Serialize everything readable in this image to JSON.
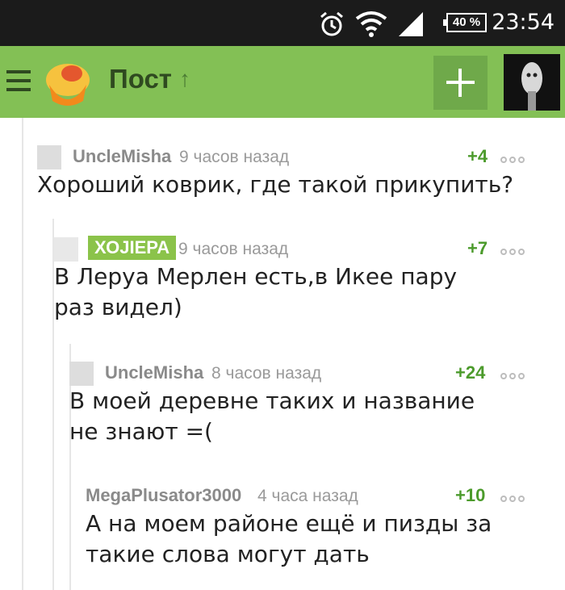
{
  "status": {
    "time": "23:54",
    "battery": "40 %"
  },
  "appbar": {
    "title": "Пост"
  },
  "comments": [
    {
      "author": "UncleMisha",
      "time": "9 часов назад",
      "score": "+4",
      "text": "Хороший коврик, где такой прикупить?"
    },
    {
      "author": "ХОJIEPA",
      "time": "9 часов назад",
      "score": "+7",
      "text": "В Леруа Мерлен есть,в Икее пару раз видел)"
    },
    {
      "author": "UncleMisha",
      "time": "8 часов назад",
      "score": "+24",
      "text": "В моей деревне таких и название не знают =("
    },
    {
      "author": "MegaPlusator3000",
      "time": "4 часа назад",
      "score": "+10",
      "text": "А на моем районе ещё и пизды за такие слова могут дать"
    }
  ]
}
